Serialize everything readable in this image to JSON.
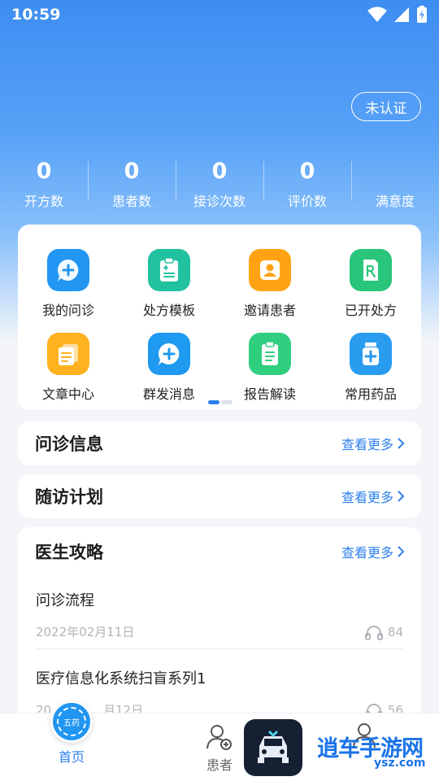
{
  "status_bar": {
    "time": "10:59"
  },
  "header": {
    "cert_label": "未认证"
  },
  "stats": [
    {
      "value": "0",
      "label": "开方数"
    },
    {
      "value": "0",
      "label": "患者数"
    },
    {
      "value": "0",
      "label": "接诊次数"
    },
    {
      "value": "0",
      "label": "评价数"
    },
    {
      "value": "",
      "label": "满意度"
    }
  ],
  "services": [
    {
      "label": "我的问诊",
      "icon": "consult-icon",
      "color": "#2196f3"
    },
    {
      "label": "处方模板",
      "icon": "clipboard-icon",
      "color": "#20c2a0"
    },
    {
      "label": "邀请患者",
      "icon": "invite-user-icon",
      "color": "#ffa313"
    },
    {
      "label": "已开处方",
      "icon": "prescription-icon",
      "color": "#28c57a"
    },
    {
      "label": "文章中心",
      "icon": "articles-icon",
      "color": "#ffb21f"
    },
    {
      "label": "群发消息",
      "icon": "broadcast-icon",
      "color": "#1e9af0"
    },
    {
      "label": "报告解读",
      "icon": "report-icon",
      "color": "#2fcf7f"
    },
    {
      "label": "常用药品",
      "icon": "medicine-icon",
      "color": "#2a9cf0"
    }
  ],
  "sections": {
    "consult": {
      "title": "问诊信息",
      "more": "查看更多"
    },
    "followup": {
      "title": "随访计划",
      "more": "查看更多"
    },
    "guide": {
      "title": "医生攻略",
      "more": "查看更多"
    }
  },
  "articles": [
    {
      "title": "问诊流程",
      "date": "2022年02月11日",
      "listens": "84"
    },
    {
      "title": "医疗信息化系统扫盲系列1",
      "date": "20",
      "date_tail": "月12日",
      "listens": "56"
    }
  ],
  "tabbar": {
    "home": {
      "label": "首页",
      "seal_text": "五药"
    },
    "patients": {
      "label": "患者"
    }
  },
  "watermark": {
    "text": "逍车手游网",
    "sub": "ysz.com"
  },
  "colors": {
    "accent": "#2f80ed",
    "hero_top": "#3d8df2"
  }
}
